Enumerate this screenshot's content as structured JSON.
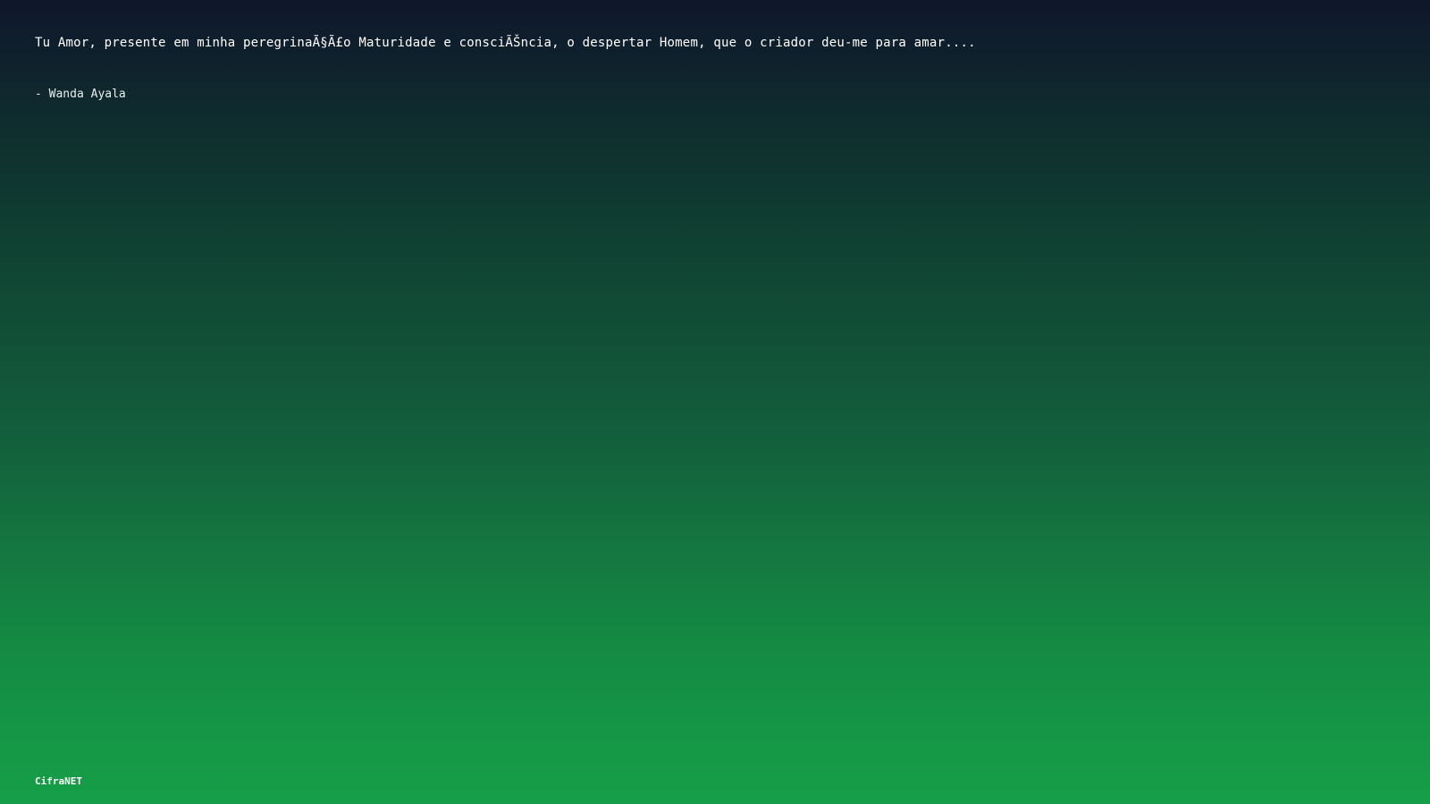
{
  "quote": {
    "text": "Tu Amor, presente em minha peregrinaÃ§Ã£o Maturidade e consciÃŠncia, o despertar Homem, que o criador deu-me para amar....",
    "author": "- Wanda Ayala"
  },
  "footer": {
    "brand": "CifraNET"
  },
  "colors": {
    "background_top": "#0f172b",
    "background_bottom": "#169f48",
    "text": "#ffffff"
  }
}
